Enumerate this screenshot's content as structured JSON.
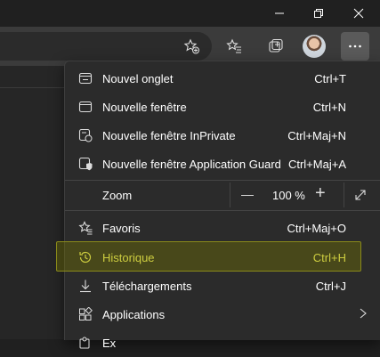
{
  "window_controls": {
    "minimize_icon": "minimize-icon",
    "restore_icon": "restore-icon",
    "close_icon": "close-icon"
  },
  "toolbar": {
    "icons": [
      "add-favorite-icon",
      "favorites-icon",
      "collections-icon",
      "profile-avatar",
      "more-icon"
    ]
  },
  "menu": {
    "items": [
      {
        "label": "Nouvel onglet",
        "shortcut": "Ctrl+T",
        "icon": "new-tab-icon"
      },
      {
        "label": "Nouvelle fenêtre",
        "shortcut": "Ctrl+N",
        "icon": "new-window-icon"
      },
      {
        "label": "Nouvelle fenêtre InPrivate",
        "shortcut": "Ctrl+Maj+N",
        "icon": "inprivate-icon"
      },
      {
        "label": "Nouvelle fenêtre Application Guard",
        "shortcut": "Ctrl+Maj+A",
        "icon": "application-guard-icon"
      }
    ],
    "zoom": {
      "label": "Zoom",
      "value": "100 %",
      "minus": "—",
      "plus": "+"
    },
    "items2": [
      {
        "label": "Favoris",
        "shortcut": "Ctrl+Maj+O",
        "icon": "favorites-star-icon"
      },
      {
        "label": "Historique",
        "shortcut": "Ctrl+H",
        "icon": "history-icon",
        "highlighted": true
      },
      {
        "label": "Téléchargements",
        "shortcut": "Ctrl+J",
        "icon": "download-icon"
      },
      {
        "label": "Applications",
        "shortcut": "",
        "icon": "apps-icon"
      }
    ],
    "partial_item_label": "Ex"
  },
  "colors": {
    "highlight": "#7a7a00",
    "highlight_text": "#ffff66",
    "menu_bg": "#2b2b2b"
  }
}
